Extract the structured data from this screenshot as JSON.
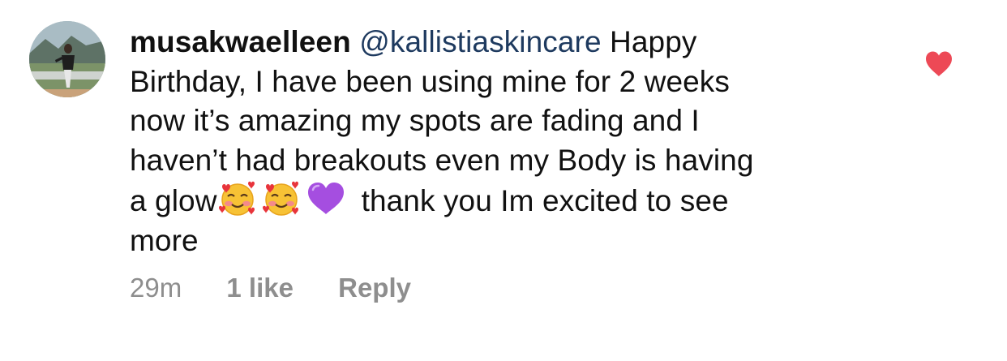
{
  "comment": {
    "username": "musakwaelleen",
    "mention": "@kallistiaskincare",
    "lines": [
      "Happy",
      "Birthday, I have been using mine for 2 weeks",
      "now it’s amazing my spots are fading and I",
      "haven’t had breakouts even my Body is having",
      "a glow",
      "thank you Im excited to see",
      "more"
    ],
    "emojis": [
      "smiling-face-with-hearts",
      "smiling-face-with-hearts",
      "purple-heart"
    ],
    "time": "29m",
    "likes": "1 like",
    "reply_label": "Reply",
    "liked": true,
    "colors": {
      "like_heart": "#ed4956",
      "meta_text": "#8e8e8e",
      "mention": "#1e3a5f"
    }
  }
}
